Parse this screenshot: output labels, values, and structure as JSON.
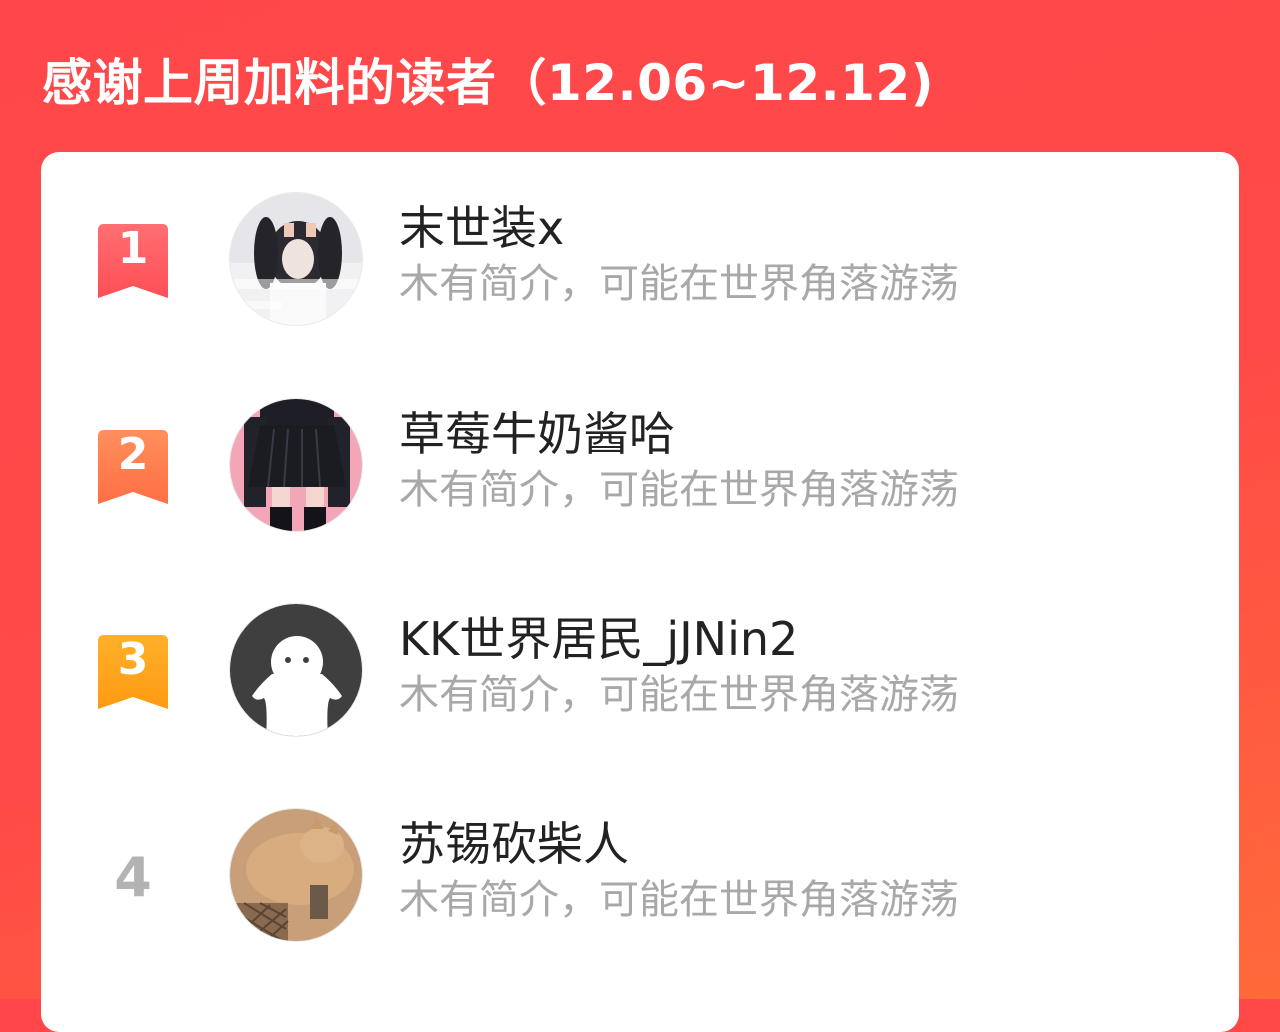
{
  "header": {
    "title": "感谢上周加料的读者（12.06~12.12)"
  },
  "colors": {
    "background": "#ff474b",
    "card": "#ffffff",
    "rank1": "#ff5a5f",
    "rank2": "#ff7a4a",
    "rank3": "#ffa31a",
    "rank_plain": "#b3b3b3",
    "name_text": "#222222",
    "bio_text": "#a8a8a8"
  },
  "readers": [
    {
      "rank": "1",
      "name": "末世装x",
      "bio": "木有简介，可能在世界角落游荡",
      "avatar": "girl-photo-avatar",
      "badge": "ribbon-badge-red"
    },
    {
      "rank": "2",
      "name": "草莓牛奶酱哈",
      "bio": "木有简介，可能在世界角落游荡",
      "avatar": "skirt-photo-avatar",
      "badge": "ribbon-badge-orange"
    },
    {
      "rank": "3",
      "name": "KK世界居民_jJNin2",
      "bio": "木有简介，可能在世界角落游荡",
      "avatar": "default-ghost-avatar",
      "badge": "ribbon-badge-gold"
    },
    {
      "rank": "4",
      "name": "苏锡砍柴人",
      "bio": "木有简介，可能在世界角落游荡",
      "avatar": "cat-photo-avatar",
      "badge": ""
    }
  ]
}
